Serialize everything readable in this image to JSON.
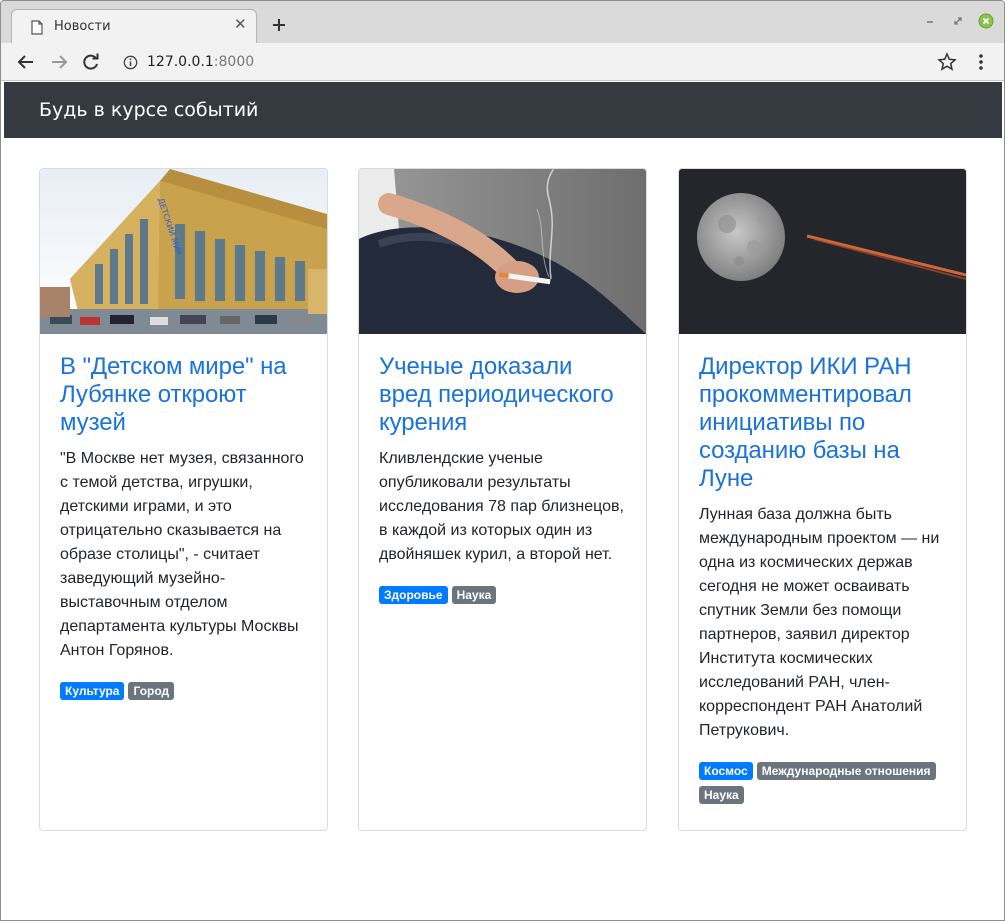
{
  "browser": {
    "tab_title": "Новости",
    "url_host": "127.0.0.1",
    "url_port": ":8000"
  },
  "navbar": {
    "brand": "Будь в курсе событий"
  },
  "cards": [
    {
      "title": "В \"Детском мире\" на Лубянке откроют музей",
      "text": "\"В Москве нет музея, связанного с темой детства, игрушки, детскими играми, и это отрицательно сказывается на образе столицы\", - считает заведующий музейно-выставочным отделом департамента культуры Москвы Антон Горянов.",
      "image": "детский-мир-building-photo",
      "tags": [
        {
          "label": "Культура",
          "style": "primary"
        },
        {
          "label": "Город",
          "style": "secondary"
        }
      ]
    },
    {
      "title": "Ученые доказали вред периодического курения",
      "text": "Кливлендские ученые опубликовали результаты исследования 78 пар близнецов, в каждой из которых один из двойняшек курил, а второй нет.",
      "image": "smoking-hand-photo",
      "tags": [
        {
          "label": "Здоровье",
          "style": "primary"
        },
        {
          "label": "Наука",
          "style": "secondary"
        }
      ]
    },
    {
      "title": "Директор ИКИ РАН прокомментировал инициативы по созданию базы на Луне",
      "text": "Лунная база должна быть международным проектом — ни одна из космических держав сегодня не может осваивать спутник Земли без помощи партнеров, заявил директор Института космических исследований РАН, член-корреспондент РАН Анатолий Петрукович.",
      "image": "moon-and-contrail-photo",
      "tags": [
        {
          "label": "Космос",
          "style": "primary"
        },
        {
          "label": "Международные отношения",
          "style": "secondary"
        },
        {
          "label": "Наука",
          "style": "secondary"
        }
      ]
    }
  ],
  "colors": {
    "navbar_bg": "#343a40",
    "link": "#1a73d9",
    "badge_primary": "#007bff",
    "badge_secondary": "#6c757d"
  }
}
